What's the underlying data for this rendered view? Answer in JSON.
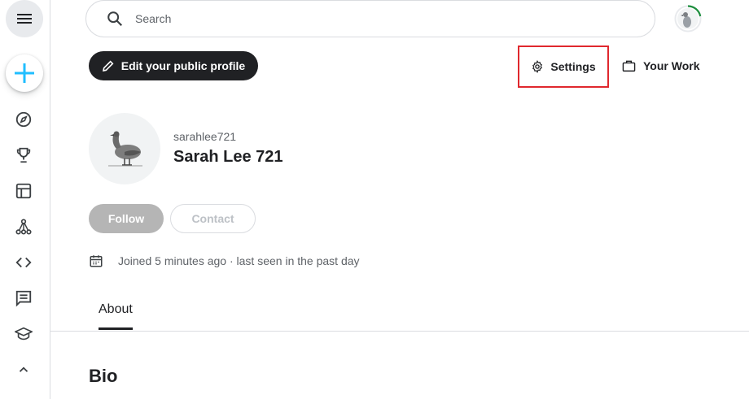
{
  "search": {
    "placeholder": "Search"
  },
  "sidebar": {
    "items": [
      {
        "icon": "compass-icon"
      },
      {
        "icon": "trophy-icon"
      },
      {
        "icon": "table-icon"
      },
      {
        "icon": "models-icon"
      },
      {
        "icon": "code-icon"
      },
      {
        "icon": "discussion-icon"
      },
      {
        "icon": "learn-icon"
      },
      {
        "icon": "chevron-up-icon"
      }
    ]
  },
  "header": {
    "edit_profile_label": "Edit your public profile",
    "settings_label": "Settings",
    "your_work_label": "Your Work"
  },
  "profile": {
    "username": "sarahlee721",
    "display_name": "Sarah Lee 721",
    "follow_label": "Follow",
    "contact_label": "Contact",
    "joined_text": "Joined 5 minutes ago · last seen in the past day"
  },
  "tabs": [
    {
      "label": "About"
    }
  ],
  "sections": {
    "bio_heading": "Bio"
  },
  "colors": {
    "accent_blue": "#20beff",
    "progress_green": "#1e8e3e",
    "highlight_red": "#e0282e",
    "dark_button": "#202124"
  }
}
